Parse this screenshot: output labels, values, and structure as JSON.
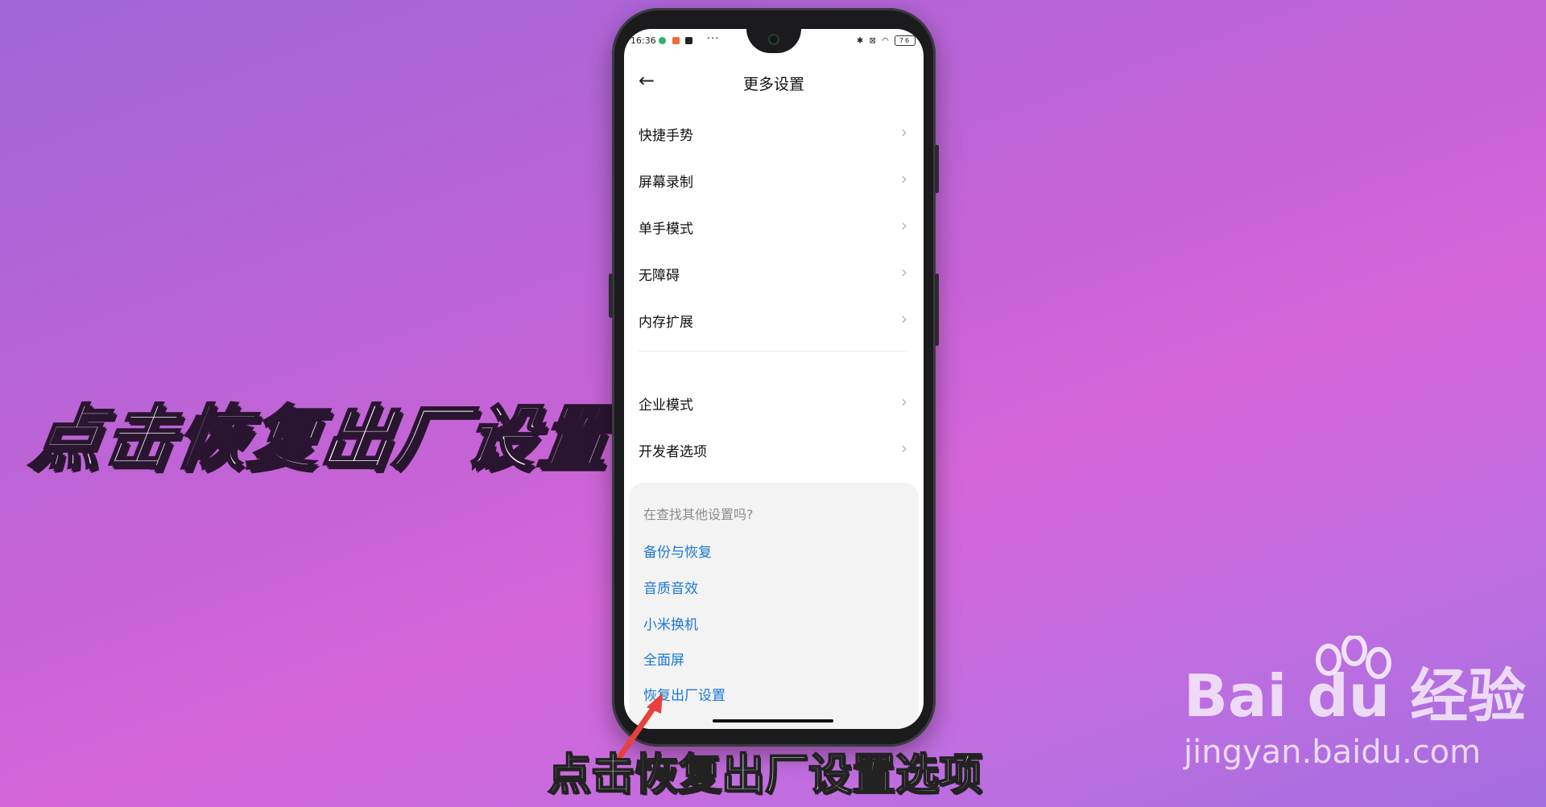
{
  "overlay": {
    "main_caption": "点击恢复出厂设置",
    "bottom_caption": "点击恢复出厂设置选项"
  },
  "watermark": {
    "brand": "Bai du 经验",
    "url": "jingyan.baidu.com"
  },
  "status_bar": {
    "time": "16:36",
    "more": "···",
    "battery": "76"
  },
  "header": {
    "title": "更多设置"
  },
  "settings_list": {
    "items": [
      {
        "label": "快捷手势"
      },
      {
        "label": "屏幕录制"
      },
      {
        "label": "单手模式"
      },
      {
        "label": "无障碍"
      },
      {
        "label": "内存扩展"
      },
      {
        "label": "企业模式"
      },
      {
        "label": "开发者选项"
      }
    ]
  },
  "suggestions": {
    "question": "在查找其他设置吗?",
    "links": [
      {
        "label": "备份与恢复"
      },
      {
        "label": "音质音效"
      },
      {
        "label": "小米换机"
      },
      {
        "label": "全面屏"
      },
      {
        "label": "恢复出厂设置"
      }
    ]
  },
  "colors": {
    "link": "#1a78d6",
    "arrow": "#e8403a"
  }
}
